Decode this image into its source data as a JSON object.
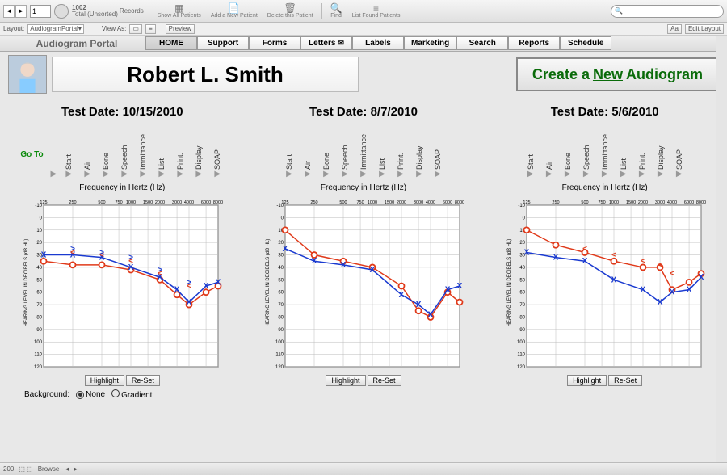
{
  "toolbar": {
    "record_num": "1",
    "records_total": "1002",
    "records_state": "Total (Unsorted)",
    "records_label": "Records",
    "show_all": "Show All Patients",
    "add_patient": "Add a New Patient",
    "delete_patient": "Delete this Patient",
    "find": "Find",
    "list_found": "List Found Patients"
  },
  "layoutbar": {
    "layout_lbl": "Layout:",
    "layout_val": "AudiogramPortal",
    "view_lbl": "View As:",
    "preview": "Preview",
    "aa": "Aa",
    "edit_layout": "Edit Layout"
  },
  "nav": {
    "portal": "Audiogram Portal",
    "home": "HOME",
    "support": "Support",
    "forms": "Forms",
    "letters": "Letters",
    "labels": "Labels",
    "marketing": "Marketing",
    "search": "Search",
    "reports": "Reports",
    "schedule": "Schedule"
  },
  "patient": {
    "name": "Robert L. Smith",
    "create_pre": "Create a ",
    "create_new": "New",
    "create_post": " Audiogram"
  },
  "steps": [
    "Start",
    "Air",
    "Bone",
    "Speech",
    "Immittance",
    "List",
    "Print.",
    "Display",
    "SOAP"
  ],
  "goto": "Go To",
  "chart_title": "Frequency in Hertz (Hz)",
  "ylabel": "HEARING LEVEL IN DECIBELS (dB HL)",
  "buttons": {
    "highlight": "Highlight",
    "reset": "Re-Set"
  },
  "background": {
    "label": "Background:",
    "none": "None",
    "gradient": "Gradient"
  },
  "status": {
    "zoom": "200",
    "mode": "Browse"
  },
  "tests": [
    {
      "date": "Test Date: 10/15/2010"
    },
    {
      "date": "Test Date: 8/7/2010"
    },
    {
      "date": "Test Date: 5/6/2010"
    }
  ],
  "chart_data": [
    {
      "type": "line",
      "title": "Frequency in Hertz (Hz)",
      "xlabel": "Frequency in Hertz (Hz)",
      "ylabel": "HEARING LEVEL IN DECIBELS (dB HL)",
      "x_ticks": [
        125,
        250,
        500,
        750,
        1000,
        1500,
        2000,
        3000,
        4000,
        6000,
        8000
      ],
      "ylim": [
        -10,
        120
      ],
      "series": [
        {
          "name": "Right (O)",
          "color": "#e03a1a",
          "x": [
            125,
            250,
            500,
            1000,
            2000,
            3000,
            4000,
            6000,
            8000
          ],
          "values": [
            35,
            38,
            38,
            42,
            50,
            62,
            70,
            60,
            55
          ]
        },
        {
          "name": "Left (X)",
          "color": "#1a3ad0",
          "x": [
            125,
            250,
            500,
            1000,
            2000,
            3000,
            4000,
            6000,
            8000
          ],
          "values": [
            30,
            30,
            32,
            40,
            48,
            58,
            68,
            55,
            52
          ]
        },
        {
          "name": "Right Bone (<)",
          "color": "#e03a1a",
          "x": [
            250,
            500,
            1000,
            2000,
            4000
          ],
          "values": [
            28,
            30,
            35,
            45,
            55
          ]
        },
        {
          "name": "Left Bone (>)",
          "color": "#1a3ad0",
          "x": [
            250,
            500,
            1000,
            2000,
            4000
          ],
          "values": [
            25,
            28,
            32,
            42,
            52
          ]
        }
      ]
    },
    {
      "type": "line",
      "title": "Frequency in Hertz (Hz)",
      "xlabel": "Frequency in Hertz (Hz)",
      "ylabel": "HEARING LEVEL IN DECIBELS (dB HL)",
      "x_ticks": [
        125,
        250,
        500,
        750,
        1000,
        1500,
        2000,
        3000,
        4000,
        6000,
        8000
      ],
      "ylim": [
        -10,
        120
      ],
      "series": [
        {
          "name": "Right (O)",
          "color": "#e03a1a",
          "x": [
            125,
            250,
            500,
            1000,
            2000,
            3000,
            4000,
            6000,
            8000
          ],
          "values": [
            10,
            30,
            35,
            40,
            55,
            75,
            80,
            60,
            68
          ]
        },
        {
          "name": "Left (X)",
          "color": "#1a3ad0",
          "x": [
            125,
            250,
            500,
            1000,
            2000,
            3000,
            4000,
            6000,
            8000
          ],
          "values": [
            25,
            35,
            38,
            42,
            62,
            70,
            78,
            58,
            55
          ]
        }
      ]
    },
    {
      "type": "line",
      "title": "Frequency in Hertz (Hz)",
      "xlabel": "Frequency in Hertz (Hz)",
      "ylabel": "HEARING LEVEL IN DECIBELS (dB HL)",
      "x_ticks": [
        125,
        250,
        500,
        750,
        1000,
        1500,
        2000,
        3000,
        4000,
        6000,
        8000
      ],
      "ylim": [
        -10,
        120
      ],
      "series": [
        {
          "name": "Right (O)",
          "color": "#e03a1a",
          "x": [
            125,
            250,
            500,
            1000,
            2000,
            3000,
            4000,
            6000,
            8000
          ],
          "values": [
            10,
            22,
            28,
            35,
            40,
            40,
            58,
            52,
            45
          ]
        },
        {
          "name": "Left (X)",
          "color": "#1a3ad0",
          "x": [
            125,
            250,
            500,
            1000,
            2000,
            3000,
            4000,
            6000,
            8000
          ],
          "values": [
            28,
            32,
            35,
            50,
            58,
            68,
            60,
            58,
            48
          ]
        },
        {
          "name": "Right Bone (<)",
          "color": "#e03a1a",
          "x": [
            500,
            1000,
            2000,
            3000,
            4000
          ],
          "values": [
            25,
            30,
            35,
            38,
            45
          ]
        }
      ]
    }
  ]
}
